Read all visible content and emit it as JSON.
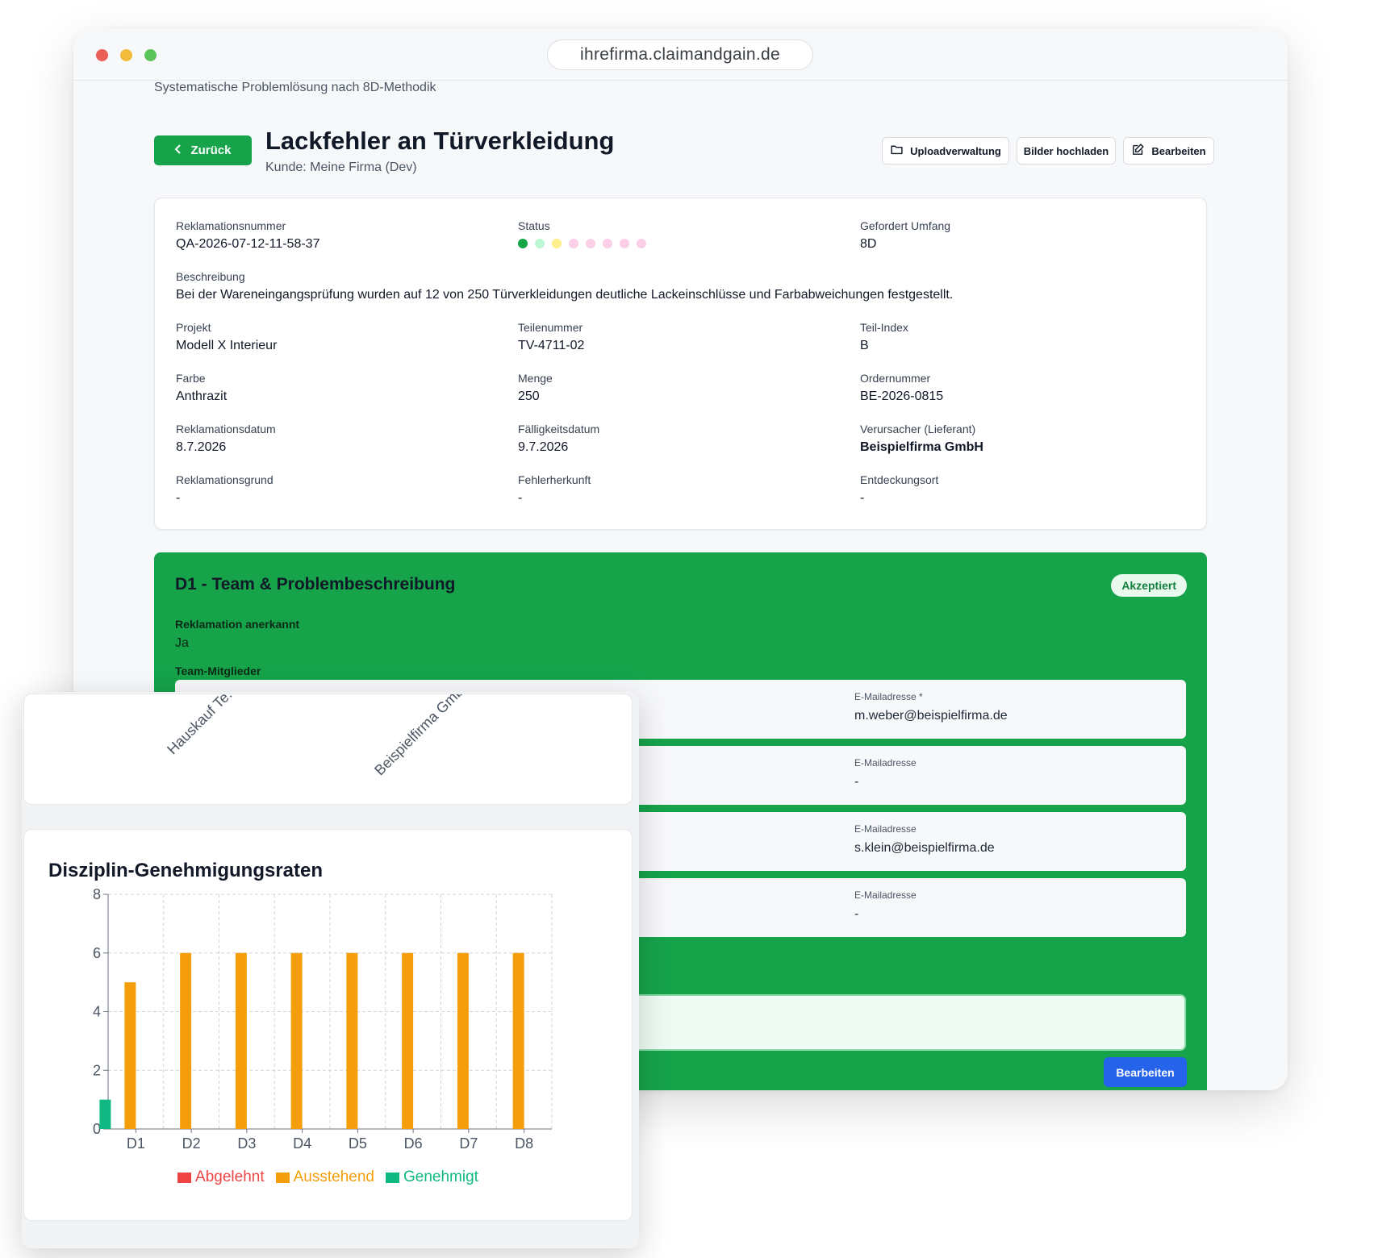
{
  "browser": {
    "url": "ihrefirma.claimandgain.de"
  },
  "header": {
    "subtitle": "Systematische Problemlösung nach 8D-Methodik",
    "back_label": "Zurück",
    "title": "Lackfehler an Türverkleidung",
    "customer": "Kunde: Meine Firma (Dev)",
    "buttons": {
      "uploads": "Uploadverwaltung",
      "images": "Bilder hochladen",
      "edit": "Bearbeiten"
    }
  },
  "info": {
    "claim_number": {
      "label": "Reklamationsnummer",
      "value": "QA-2026-07-12-11-58-37"
    },
    "status": {
      "label": "Status",
      "dots": [
        "#16a34a",
        "#bbf7d0",
        "#fef08a",
        "#fbcfe8",
        "#fbcfe8",
        "#fbcfe8",
        "#fbcfe8",
        "#fbcfe8"
      ]
    },
    "scope": {
      "label": "Gefordert Umfang",
      "value": "8D"
    },
    "description": {
      "label": "Beschreibung",
      "value": "Bei der Wareneingangsprüfung wurden auf 12 von 250 Türverkleidungen deutliche Lackeinschlüsse und Farbabweichungen festgestellt."
    },
    "project": {
      "label": "Projekt",
      "value": "Modell X Interieur"
    },
    "part_number": {
      "label": "Teilenummer",
      "value": "TV-4711-02"
    },
    "part_index": {
      "label": "Teil-Index",
      "value": "B"
    },
    "color": {
      "label": "Farbe",
      "value": "Anthrazit"
    },
    "quantity": {
      "label": "Menge",
      "value": "250"
    },
    "order_number": {
      "label": "Ordernummer",
      "value": "BE-2026-0815"
    },
    "claim_date": {
      "label": "Reklamationsdatum",
      "value": "8.7.2026"
    },
    "due_date": {
      "label": "Fälligkeitsdatum",
      "value": "9.7.2026"
    },
    "causer": {
      "label": "Verursacher (Lieferant)",
      "value": "Beispielfirma GmbH"
    },
    "reason": {
      "label": "Reklamationsgrund",
      "value": "-"
    },
    "origin": {
      "label": "Fehlerherkunft",
      "value": "-"
    },
    "discovery": {
      "label": "Entdeckungsort",
      "value": "-"
    }
  },
  "d1": {
    "title": "D1 - Team & Problembeschreibung",
    "badge": "Akzeptiert",
    "acknowledged_label": "Reklamation anerkannt",
    "acknowledged_value": "Ja",
    "team_label": "Team-Mitglieder",
    "members": [
      {
        "email_label": "E-Mailadresse *",
        "email": "m.weber@beispielfirma.de"
      },
      {
        "email_label": "E-Mailadresse",
        "email": "-"
      },
      {
        "email_label": "E-Mailadresse",
        "email": "s.klein@beispielfirma.de"
      },
      {
        "email_label": "E-Mailadresse",
        "email": "-"
      }
    ],
    "edit_label": "Bearbeiten"
  },
  "overlay": {
    "rotated_labels": [
      "Hauskauf Te...",
      "Beispielfirma Gmb..."
    ]
  },
  "chart_data": {
    "type": "bar",
    "title": "Disziplin-Genehmigungsraten",
    "categories": [
      "D1",
      "D2",
      "D3",
      "D4",
      "D5",
      "D6",
      "D7",
      "D8"
    ],
    "y_ticks": [
      "0",
      "2",
      "4",
      "6",
      "8"
    ],
    "ylim": [
      0,
      8
    ],
    "grid": true,
    "legend_position": "bottom",
    "series": [
      {
        "name": "Abgelehnt",
        "color": "#ef4444",
        "values": [
          0,
          0,
          0,
          0,
          0,
          0,
          0,
          0
        ]
      },
      {
        "name": "Ausstehend",
        "color": "#f59e0b",
        "values": [
          5,
          6,
          6,
          6,
          6,
          6,
          6,
          6
        ]
      },
      {
        "name": "Genehmigt",
        "color": "#10b981",
        "values": [
          1,
          0,
          0,
          0,
          0,
          0,
          0,
          0
        ]
      }
    ]
  }
}
